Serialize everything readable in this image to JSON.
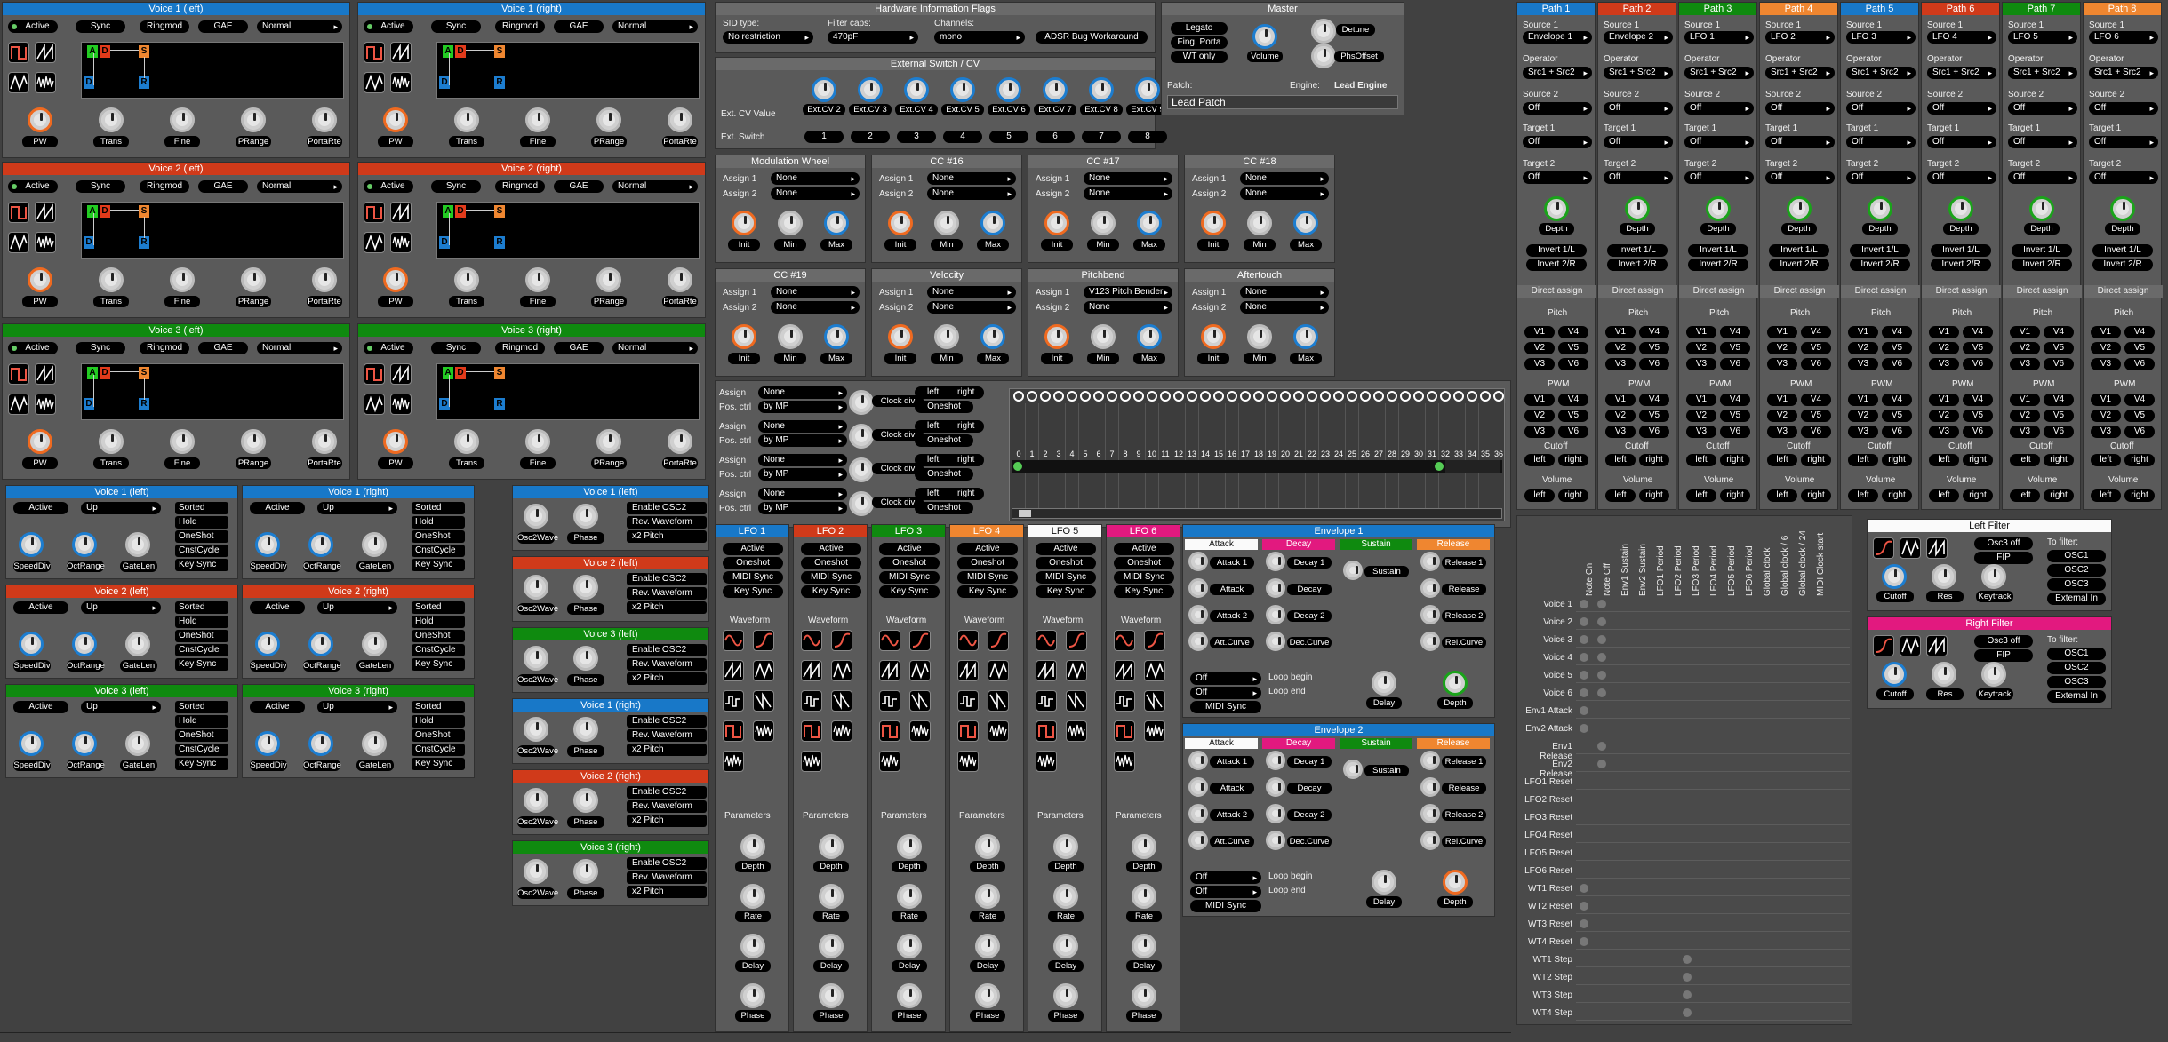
{
  "voices_top": [
    {
      "title": "Voice 1 (left)",
      "color": "b-blue",
      "active": "Active",
      "sync": "Sync",
      "ringmod": "Ringmod",
      "gae": "GAE",
      "mode": "Normal",
      "knobs": [
        "PW",
        "Trans",
        "Fine",
        "PRange",
        "PortaRte"
      ]
    },
    {
      "title": "Voice 1 (right)",
      "color": "b-blue",
      "active": "Active",
      "sync": "Sync",
      "ringmod": "Ringmod",
      "gae": "GAE",
      "mode": "Normal",
      "knobs": [
        "PW",
        "Trans",
        "Fine",
        "PRange",
        "PortaRte"
      ]
    },
    {
      "title": "Voice 2 (left)",
      "color": "b-red",
      "active": "Active",
      "sync": "Sync",
      "ringmod": "Ringmod",
      "gae": "GAE",
      "mode": "Normal",
      "knobs": [
        "PW",
        "Trans",
        "Fine",
        "PRange",
        "PortaRte"
      ]
    },
    {
      "title": "Voice 2 (right)",
      "color": "b-red",
      "active": "Active",
      "sync": "Sync",
      "ringmod": "Ringmod",
      "gae": "GAE",
      "mode": "Normal",
      "knobs": [
        "PW",
        "Trans",
        "Fine",
        "PRange",
        "PortaRte"
      ]
    },
    {
      "title": "Voice 3 (left)",
      "color": "b-green",
      "active": "Active",
      "sync": "Sync",
      "ringmod": "Ringmod",
      "gae": "GAE",
      "mode": "Normal",
      "knobs": [
        "PW",
        "Trans",
        "Fine",
        "PRange",
        "PortaRte"
      ]
    },
    {
      "title": "Voice 3 (right)",
      "color": "b-green",
      "active": "Active",
      "sync": "Sync",
      "ringmod": "Ringmod",
      "gae": "GAE",
      "mode": "Normal",
      "knobs": [
        "PW",
        "Trans",
        "Fine",
        "PRange",
        "PortaRte"
      ]
    }
  ],
  "adsr_letters": [
    "A",
    "D",
    "S",
    "R"
  ],
  "arps": [
    {
      "title": "Voice 1 (left)",
      "color": "b-blue"
    },
    {
      "title": "Voice 1 (right)",
      "color": "b-blue"
    },
    {
      "title": "Voice 2 (left)",
      "color": "b-red"
    },
    {
      "title": "Voice 2 (right)",
      "color": "b-red"
    },
    {
      "title": "Voice 3 (left)",
      "color": "b-green"
    },
    {
      "title": "Voice 3 (right)",
      "color": "b-green"
    }
  ],
  "arp_labels": {
    "active": "Active",
    "dir": "Up",
    "opts": [
      "Sorted",
      "Hold",
      "OneShot",
      "CnstCycle",
      "Key Sync"
    ],
    "knobs": [
      "SpeedDiv",
      "OctRange",
      "GateLen"
    ]
  },
  "osc2": [
    {
      "title": "Voice 1 (left)",
      "color": "b-blue"
    },
    {
      "title": "Voice 2 (left)",
      "color": "b-red"
    },
    {
      "title": "Voice 3 (left)",
      "color": "b-green"
    },
    {
      "title": "Voice 1 (right)",
      "color": "b-blue"
    },
    {
      "title": "Voice 2 (right)",
      "color": "b-red"
    },
    {
      "title": "Voice 3 (right)",
      "color": "b-green"
    }
  ],
  "osc2_labels": {
    "knobs": [
      "Osc2Wave",
      "Phase"
    ],
    "opts": [
      "Enable OSC2",
      "Rev. Waveform",
      "x2 Pitch"
    ]
  },
  "hw": {
    "title": "Hardware Information Flags",
    "sid_label": "SID type:",
    "sid": "No restriction",
    "filter_label": "Filter caps:",
    "filter": "470pF",
    "ch_label": "Channels:",
    "ch": "mono",
    "adsr_bug": "ADSR Bug Workaround"
  },
  "ext": {
    "title": "External Switch / CV",
    "cv_label": "Ext. CV Value",
    "cv": [
      "Ext.CV 2",
      "Ext.CV 3",
      "Ext.CV 4",
      "Ext.CV 5",
      "Ext.CV 6",
      "Ext.CV 7",
      "Ext.CV 8",
      "Ext.CV 9"
    ],
    "sw_label": "Ext. Switch",
    "sw": [
      "1",
      "2",
      "3",
      "4",
      "5",
      "6",
      "7",
      "8"
    ]
  },
  "master": {
    "title": "Master",
    "legato": "Legato",
    "fing": "Fing. Porta",
    "wt": "WT only",
    "volume": "Volume",
    "detune": "Detune",
    "phsoffset": "PhsOffset",
    "patch_label": "Patch:",
    "engine_label": "Engine:",
    "engine": "Lead Engine",
    "patch": "Lead Patch"
  },
  "mods": [
    {
      "title": "Modulation Wheel",
      "a1": "None",
      "a2": "None"
    },
    {
      "title": "CC #16",
      "a1": "None",
      "a2": "None"
    },
    {
      "title": "CC #17",
      "a1": "None",
      "a2": "None"
    },
    {
      "title": "CC #18",
      "a1": "None",
      "a2": "None"
    },
    {
      "title": "CC #19",
      "a1": "None",
      "a2": "None"
    },
    {
      "title": "Velocity",
      "a1": "None",
      "a2": "None"
    },
    {
      "title": "Pitchbend",
      "a1": "V123 Pitch Bender",
      "a2": "None"
    },
    {
      "title": "Aftertouch",
      "a1": "None",
      "a2": "None"
    }
  ],
  "mod_labels": {
    "assign1": "Assign 1",
    "assign2": "Assign 2",
    "knobs": [
      "Init",
      "Min",
      "Max"
    ]
  },
  "seqrows": [
    {
      "assign": "Assign",
      "assign_val": "None",
      "pos": "Pos. ctrl",
      "pos_val": "by MP",
      "clk": "Clock div",
      "oneshot": "Oneshot",
      "left": "left",
      "right": "right"
    },
    {
      "assign": "Assign",
      "assign_val": "None",
      "pos": "Pos. ctrl",
      "pos_val": "by MP",
      "clk": "Clock div",
      "oneshot": "Oneshot",
      "left": "left",
      "right": "right"
    },
    {
      "assign": "Assign",
      "assign_val": "None",
      "pos": "Pos. ctrl",
      "pos_val": "by MP",
      "clk": "Clock div",
      "oneshot": "Oneshot",
      "left": "left",
      "right": "right"
    },
    {
      "assign": "Assign",
      "assign_val": "None",
      "pos": "Pos. ctrl",
      "pos_val": "by MP",
      "clk": "Clock div",
      "oneshot": "Oneshot",
      "left": "left",
      "right": "right"
    }
  ],
  "seq_steps": [
    "0",
    "1",
    "2",
    "3",
    "4",
    "5",
    "6",
    "7",
    "8",
    "9",
    "10",
    "11",
    "12",
    "13",
    "14",
    "15",
    "16",
    "17",
    "18",
    "19",
    "20",
    "21",
    "22",
    "23",
    "24",
    "25",
    "26",
    "27",
    "28",
    "29",
    "30",
    "31",
    "32",
    "33",
    "34",
    "35",
    "36"
  ],
  "lfos": [
    {
      "title": "LFO 1",
      "color": "b-blue"
    },
    {
      "title": "LFO 2",
      "color": "b-red"
    },
    {
      "title": "LFO 3",
      "color": "b-green"
    },
    {
      "title": "LFO 4",
      "color": "b-orange"
    },
    {
      "title": "LFO 5",
      "color": "b-white"
    },
    {
      "title": "LFO 6",
      "color": "b-pink"
    }
  ],
  "lfo_labels": {
    "opts": [
      "Active",
      "Oneshot",
      "MIDI Sync",
      "Key Sync"
    ],
    "waveform": "Waveform",
    "parameters": "Parameters",
    "knobs": [
      "Depth",
      "Rate",
      "Delay",
      "Phase"
    ]
  },
  "envs": [
    {
      "title": "Envelope 1"
    },
    {
      "title": "Envelope 2"
    }
  ],
  "env_labels": {
    "attack": "Attack",
    "decay": "Decay",
    "sustain": "Sustain",
    "release": "Release",
    "a": [
      "Attack 1",
      "Attack",
      "Attack 2",
      "Att.Curve"
    ],
    "d": [
      "Decay 1",
      "Decay",
      "Decay 2",
      "Dec.Curve"
    ],
    "s": [
      "Sustain"
    ],
    "r": [
      "Release 1",
      "Release",
      "Release 2",
      "Rel.Curve"
    ],
    "loop_begin": "Loop begin",
    "loop_end": "Loop end",
    "off": "Off",
    "midisync": "MIDI Sync",
    "delay": "Delay",
    "depth": "Depth"
  },
  "paths": [
    {
      "title": "Path 1",
      "color": "b-blue",
      "src1": "Envelope 1"
    },
    {
      "title": "Path 2",
      "color": "b-red",
      "src1": "Envelope 2"
    },
    {
      "title": "Path 3",
      "color": "b-green",
      "src1": "LFO 1"
    },
    {
      "title": "Path 4",
      "color": "b-orange",
      "src1": "LFO 2"
    },
    {
      "title": "Path 5",
      "color": "b-blue",
      "src1": "LFO 3"
    },
    {
      "title": "Path 6",
      "color": "b-red",
      "src1": "LFO 4"
    },
    {
      "title": "Path 7",
      "color": "b-green",
      "src1": "LFO 5"
    },
    {
      "title": "Path 8",
      "color": "b-orange",
      "src1": "LFO 6"
    }
  ],
  "path_labels": {
    "source1": "Source 1",
    "operator": "Operator",
    "op": "Src1 + Src2",
    "source2": "Source 2",
    "off": "Off",
    "target1": "Target 1",
    "target2": "Target 2",
    "depth": "Depth",
    "inv1": "Invert 1/L",
    "inv2": "Invert 2/R",
    "direct": "Direct assign",
    "pitch": "Pitch",
    "pwm": "PWM",
    "cutoff": "Cutoff",
    "volume": "Volume",
    "v": [
      "V1",
      "V4",
      "V2",
      "V5",
      "V3",
      "V6"
    ],
    "left": "left",
    "right": "right"
  },
  "trig": {
    "cols": [
      "Note On",
      "Note Off",
      "Env1 Sustain",
      "Env2 Sustain",
      "LFO1 Period",
      "LFO2 Period",
      "LFO3 Period",
      "LFO4 Period",
      "LFO5 Period",
      "LFO6 Period",
      "Global clock",
      "Global clock / 6",
      "Global clock / 24",
      "MIDI Clock start"
    ],
    "rows": [
      "Voice 1",
      "Voice 2",
      "Voice 3",
      "Voice 4",
      "Voice 5",
      "Voice 6",
      "Env1 Attack",
      "Env2 Attack",
      "Env1 Release",
      "Env2 Release",
      "LFO1 Reset",
      "LFO2 Reset",
      "LFO3 Reset",
      "LFO4 Reset",
      "LFO5 Reset",
      "LFO6 Reset",
      "WT1 Reset",
      "WT2 Reset",
      "WT3 Reset",
      "WT4 Reset",
      "WT1 Step",
      "WT2 Step",
      "WT3 Step",
      "WT4 Step"
    ]
  },
  "filters": [
    {
      "title": "Left Filter",
      "color": "b-white"
    },
    {
      "title": "Right Filter",
      "color": "b-pink"
    }
  ],
  "filter_labels": {
    "osc3": "Osc3 off",
    "fip": "FIP",
    "to": "To filter:",
    "outs": [
      "OSC1",
      "OSC2",
      "OSC3",
      "External In"
    ],
    "knobs": [
      "Cutoff",
      "Res",
      "Keytrack"
    ]
  }
}
